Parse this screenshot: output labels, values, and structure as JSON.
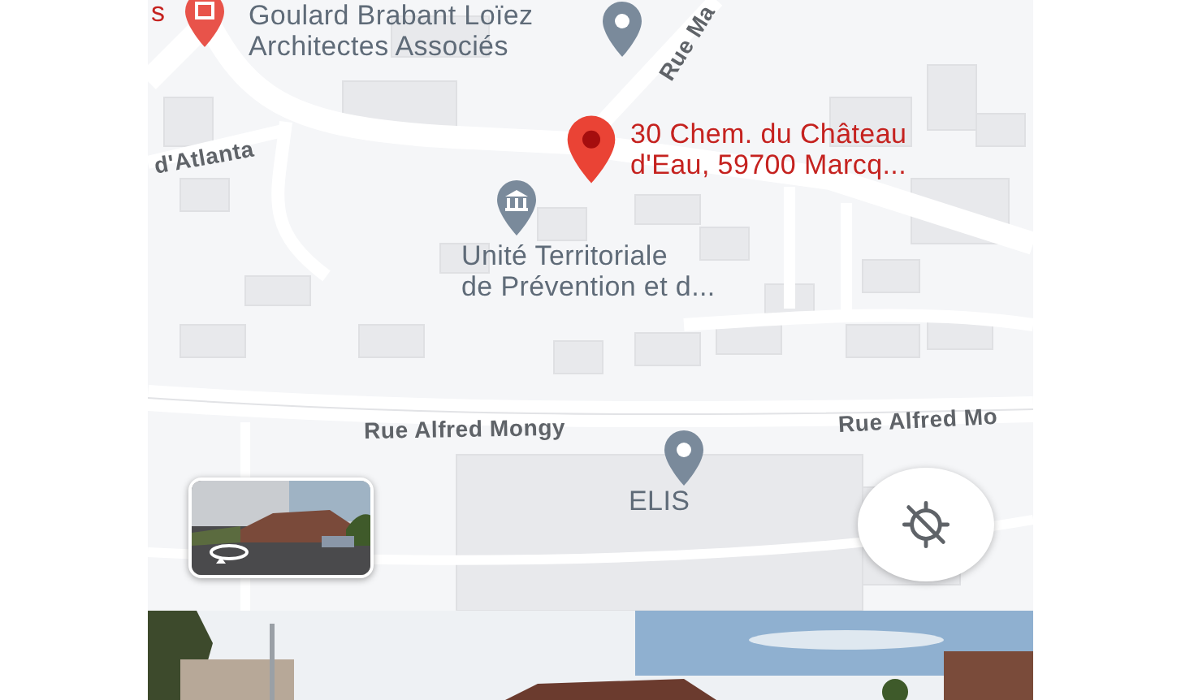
{
  "map": {
    "street_labels": [
      {
        "text": "Rue Ma"
      },
      {
        "text": "d'Atlanta"
      },
      {
        "text": "Rue Alfred Mongy"
      },
      {
        "text": "Rue Alfred Mo"
      }
    ],
    "places": [
      {
        "kind": "red_pin",
        "lines": [
          "s"
        ]
      },
      {
        "kind": "grey_pin",
        "lines": [
          "Goulard Brabant Loïez",
          "Architectes Associés"
        ]
      },
      {
        "kind": "selected_pin",
        "lines": [
          "30 Chem. du Château",
          "d'Eau, 59700 Marcq..."
        ]
      },
      {
        "kind": "civic_pin",
        "lines": [
          "Unité Territoriale",
          "de Prévention et d..."
        ]
      },
      {
        "kind": "grey_pin",
        "lines": [
          "ELIS"
        ]
      }
    ]
  }
}
